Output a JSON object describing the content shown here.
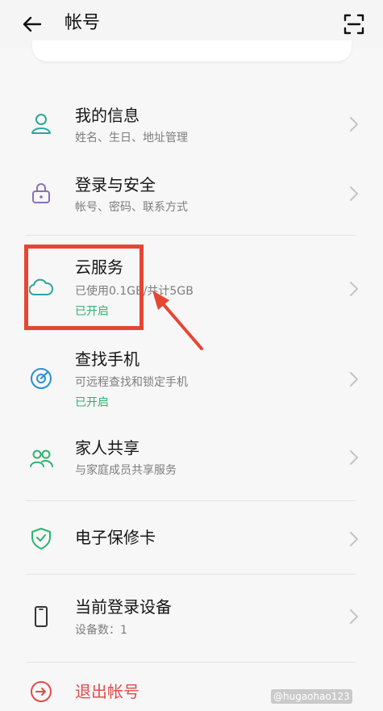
{
  "header": {
    "title": "帐号",
    "back_icon": "back-arrow-icon",
    "scan_icon": "scan-icon"
  },
  "items": [
    {
      "title": "我的信息",
      "subtitle": "姓名、生日、地址管理",
      "icon": "person-icon"
    },
    {
      "title": "登录与安全",
      "subtitle": "帐号、密码、联系方式",
      "icon": "lock-icon"
    },
    {
      "title": "云服务",
      "subtitle": "已使用0.1GB/共计5GB",
      "status": "已开启",
      "icon": "cloud-icon"
    },
    {
      "title": "查找手机",
      "subtitle": "可远程查找和锁定手机",
      "status": "已开启",
      "icon": "find-phone-icon"
    },
    {
      "title": "家人共享",
      "subtitle": "与家庭成员共享服务",
      "icon": "family-icon"
    },
    {
      "title": "电子保修卡",
      "icon": "shield-icon"
    },
    {
      "title": "当前登录设备",
      "subtitle": "设备数：1",
      "icon": "phone-icon"
    }
  ],
  "logout": {
    "label": "退出帐号",
    "icon": "logout-icon"
  },
  "watermark": "@hugaohao123",
  "colors": {
    "accent_teal": "#2aa6a0",
    "status_green": "#2fb36f",
    "logout_red": "#e04b4b",
    "highlight_red": "#e64633"
  }
}
